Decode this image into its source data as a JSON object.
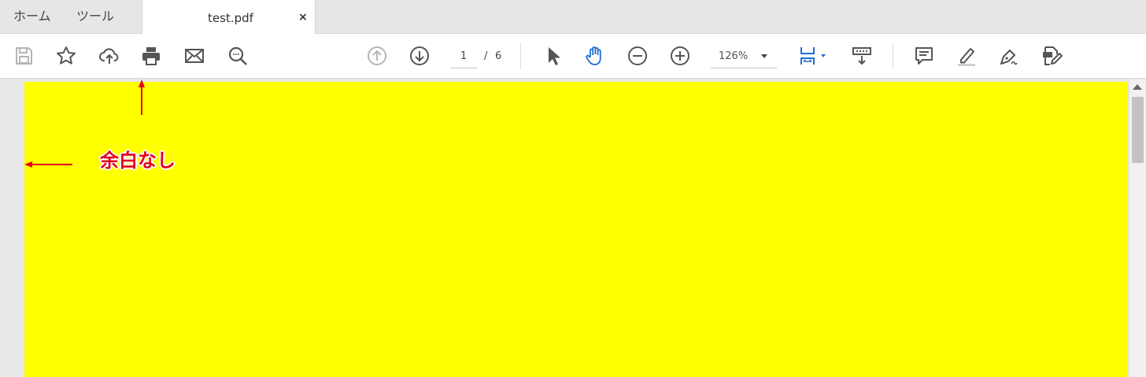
{
  "tabs": {
    "home_label": "ホーム",
    "tools_label": "ツール",
    "document_label": "test.pdf",
    "close_glyph": "×"
  },
  "toolbar": {
    "page_current": "1",
    "page_separator": "/",
    "page_total": "6",
    "zoom_value": "126%",
    "icons": [
      "save-icon",
      "bookmark-star-icon",
      "cloud-upload-icon",
      "print-icon",
      "email-icon",
      "search-icon",
      "previous-page-icon",
      "next-page-icon",
      "select-cursor-icon",
      "hand-tool-icon",
      "zoom-out-icon",
      "zoom-in-icon",
      "fit-page-icon",
      "read-mode-icon",
      "comment-icon",
      "highlight-icon",
      "sign-icon",
      "edit-pdf-icon"
    ]
  },
  "document": {
    "page_color": "#ffff00"
  },
  "annotation": {
    "label": "余白なし",
    "color": "#e3001b"
  },
  "colors": {
    "accent_blue": "#1e6fd4",
    "icon_gray": "#555555"
  }
}
